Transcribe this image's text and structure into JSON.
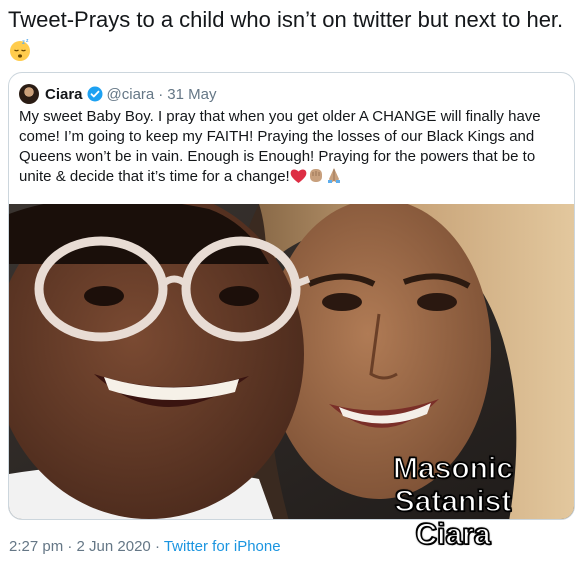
{
  "tweet": {
    "text": "Tweet-Prays to a child who isn’t on twitter but next to her.",
    "emoji_icon": "sleeping-face-icon"
  },
  "quoted_tweet": {
    "name": "Ciara",
    "verified_icon": "verified-badge-icon",
    "handle": "@ciara",
    "separator": "·",
    "date": "31 May",
    "text": "My sweet Baby Boy. I pray that when you get older A CHANGE will finally have come! I’m going to keep my FAITH! Praying the losses of our Black Kings and Queens won’t be in vain. Enough is Enough! Praying for the powers that be to unite & decide that it’s time for a change!",
    "emojis": [
      "red-heart-icon",
      "raised-fist-icon",
      "folded-hands-icon"
    ]
  },
  "meta": {
    "time": "2:27 pm · 2 Jun 2020",
    "separator": "·",
    "source": "Twitter for iPhone"
  },
  "watermark": {
    "line1": "Masonic",
    "line2": "Satanist",
    "line3": "Ciara"
  },
  "colors": {
    "link_blue": "#1b95e0",
    "muted_gray": "#657786",
    "border": "#ccd6dd",
    "verified_blue": "#1da1f2"
  }
}
